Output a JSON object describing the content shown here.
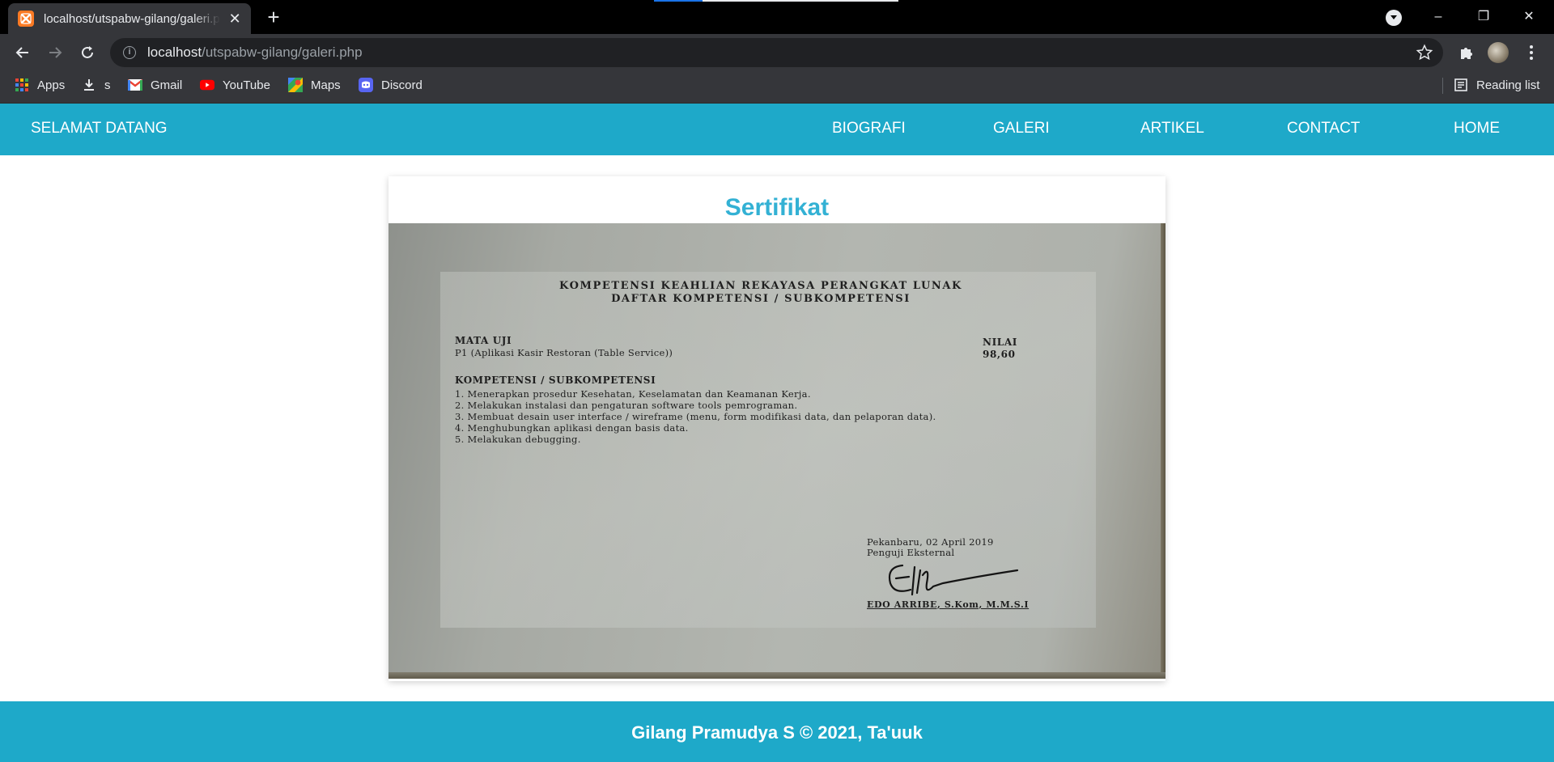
{
  "browser": {
    "tab_title": "localhost/utspabw-gilang/galeri.php",
    "tab_close": "✕",
    "new_tab": "+",
    "url_host": "localhost",
    "url_path": "/utspabw-gilang/galeri.php",
    "window_controls": [
      "–",
      "❐",
      "✕"
    ],
    "bookmarks": [
      {
        "label": "Apps",
        "icon": "apps-grid-icon"
      },
      {
        "label": "s",
        "icon": "download-icon"
      },
      {
        "label": "Gmail",
        "icon": "gmail-icon"
      },
      {
        "label": "YouTube",
        "icon": "youtube-icon"
      },
      {
        "label": "Maps",
        "icon": "maps-icon"
      },
      {
        "label": "Discord",
        "icon": "discord-icon"
      }
    ],
    "reading_list": "Reading list"
  },
  "navbar": {
    "brand": "SELAMAT DATANG",
    "links": [
      "BIOGRAFI",
      "GALERI",
      "ARTIKEL",
      "CONTACT",
      "HOME"
    ]
  },
  "card": {
    "title": "Sertifikat",
    "certificate": {
      "heading_1": "KOMPETENSI KEAHLIAN REKAYASA PERANGKAT LUNAK",
      "heading_2": "DAFTAR KOMPETENSI / SUBKOMPETENSI",
      "mata_uji_label": "MATA UJI",
      "mata_uji_value": "P1 (Aplikasi Kasir Restoran (Table Service))",
      "nilai_label": "NILAI",
      "nilai_value": "98,60",
      "kompetensi_label": "KOMPETENSI / SUBKOMPETENSI",
      "items": [
        "1. Menerapkan prosedur Kesehatan, Keselamatan dan Keamanan Kerja.",
        "2. Melakukan instalasi dan pengaturan software tools pemrograman.",
        "3. Membuat desain user interface / wireframe (menu, form modifikasi data, dan pelaporan data).",
        "4. Menghubungkan aplikasi dengan basis data.",
        "5. Melakukan debugging."
      ],
      "place_date": "Pekanbaru, 02 April 2019",
      "examiner_role": "Penguji Eksternal",
      "examiner_name": "EDO ARRIBE, S.Kom, M.M.S.I"
    }
  },
  "footer": {
    "text": "Gilang Pramudya S © 2021, Ta'uuk"
  },
  "colors": {
    "accent": "#1ea9c9",
    "title": "#33b1d4"
  }
}
